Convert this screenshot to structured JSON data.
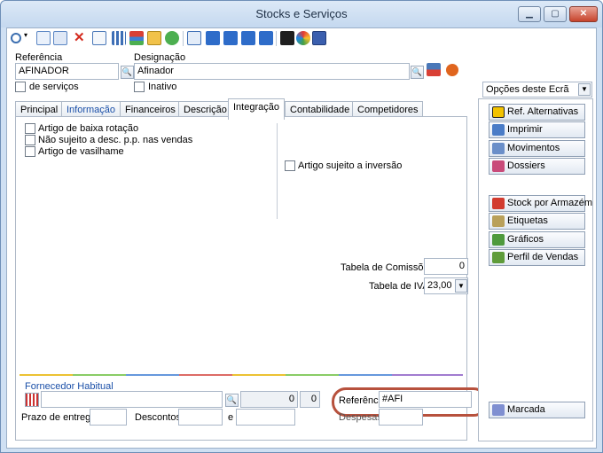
{
  "window": {
    "title": "Stocks e Serviços",
    "minimize_label": "▁",
    "maximize_label": "▢",
    "close_label": "✕"
  },
  "toolbar": {
    "icons": [
      "search-icon",
      "new-document-icon",
      "copy-icon",
      "delete-icon",
      "edit-icon",
      "grid-icon",
      "hierarchy-icon",
      "folder-icon",
      "refresh-icon",
      "preview-icon",
      "first-record-icon",
      "previous-record-icon",
      "next-record-icon",
      "last-record-icon",
      "online-icon",
      "color-wheel-icon",
      "save-icon"
    ]
  },
  "header": {
    "referencia_label": "Referência",
    "referencia_value": "AFINADOR",
    "designacao_label": "Designação",
    "designacao_value": "Afinador",
    "servicos_label": "de serviços",
    "inativo_label": "Inativo"
  },
  "tabs": [
    {
      "label": "Principal"
    },
    {
      "label": "Informação"
    },
    {
      "label": "Financeiros"
    },
    {
      "label": "Descrição"
    },
    {
      "label": "Integração"
    },
    {
      "label": "Contabilidade"
    },
    {
      "label": "Competidores"
    }
  ],
  "integracao": {
    "baixa_rotacao": "Artigo de baixa rotação",
    "nao_sujeito": "Não sujeito a desc. p.p. nas vendas",
    "vasilhame": "Artigo de vasilhame",
    "inversao": "Artigo sujeito a inversão",
    "comissoes_label": "Tabela de Comissões",
    "comissoes_value": "0",
    "iva_label": "Tabela de IVA",
    "iva_value": "23,00"
  },
  "fornecedor": {
    "title": "Fornecedor Habitual",
    "value_1": "0",
    "value_2": "0",
    "referencia_label": "Referência",
    "referencia_value": "#AFI",
    "prazo_label": "Prazo de entrega",
    "descontos_label": "Descontos",
    "e_label": "e",
    "despesas_label": "Despesas"
  },
  "side": {
    "screen_options": "Opções deste Ecrã",
    "buttons": [
      {
        "label": "Ref. Alternativas",
        "icon": "ref-alternatives-icon",
        "color": "#f2c200"
      },
      {
        "label": "Imprimir",
        "icon": "printer-icon",
        "color": "#4a7cc7"
      },
      {
        "label": "Movimentos",
        "icon": "movements-icon",
        "color": "#6b8fc9"
      },
      {
        "label": "Dossiers",
        "icon": "dossiers-icon",
        "color": "#c94b7a"
      },
      {
        "label": "Stock por Armazém",
        "icon": "warehouse-stock-icon",
        "color": "#d23b2f"
      },
      {
        "label": "Etiquetas",
        "icon": "labels-icon",
        "color": "#b9a05a"
      },
      {
        "label": "Gráficos",
        "icon": "charts-icon",
        "color": "#4f9a3d"
      },
      {
        "label": "Perfil de Vendas",
        "icon": "sales-profile-icon",
        "color": "#5f9c3a"
      },
      {
        "label": "Marcada",
        "icon": "bookmark-icon",
        "color": "#7f8fd1"
      }
    ]
  },
  "colors": {
    "highlight_ring": "#b7513d",
    "tab_blue_text": "#1a4fa8"
  }
}
